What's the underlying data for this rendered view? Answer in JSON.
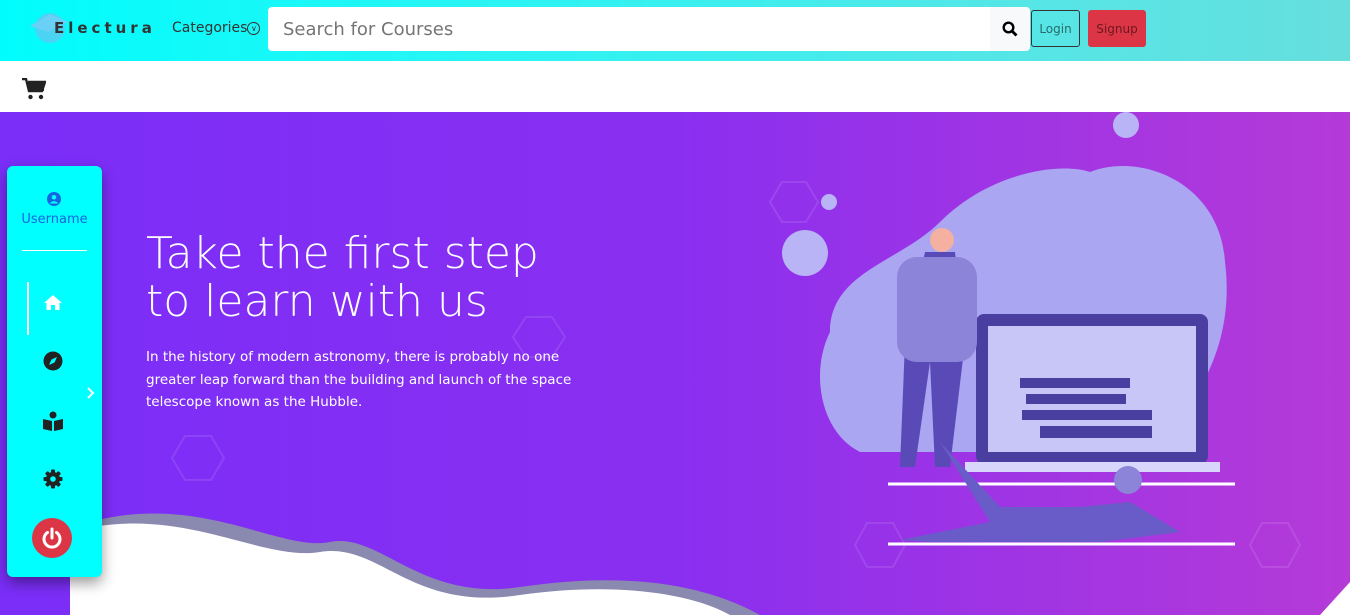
{
  "navbar": {
    "brand": "Electura",
    "categories_label": "Categories",
    "search_placeholder": "Search for Courses",
    "login_label": "Login",
    "signup_label": "Signup"
  },
  "hero": {
    "title_line1": "Take the first step",
    "title_line2": "to learn with us",
    "description": "In the history of modern astronomy, there is probably no one greater leap forward than the building and launch of the space telescope known as the Hubble."
  },
  "sidebar": {
    "username": "Username",
    "items": [
      "home",
      "explore",
      "courses",
      "settings",
      "logout"
    ]
  },
  "colors": {
    "nav": "#00ffff",
    "hero_start": "#7a2ef8",
    "hero_end": "#b53ad8",
    "signup": "#dc3545",
    "username": "#1565e0"
  }
}
